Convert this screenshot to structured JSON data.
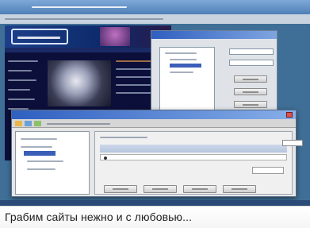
{
  "caption": {
    "text": "Грабим сайты нежно и с любовью..."
  },
  "colors": {
    "desktop": "#3f6f96",
    "site_background": "#0b0f3a",
    "site_header": "#1d3f8a",
    "dialog_body": "#e6e6e6",
    "title_bar": "#2f5fc0",
    "selection": "#3b5fb8"
  }
}
